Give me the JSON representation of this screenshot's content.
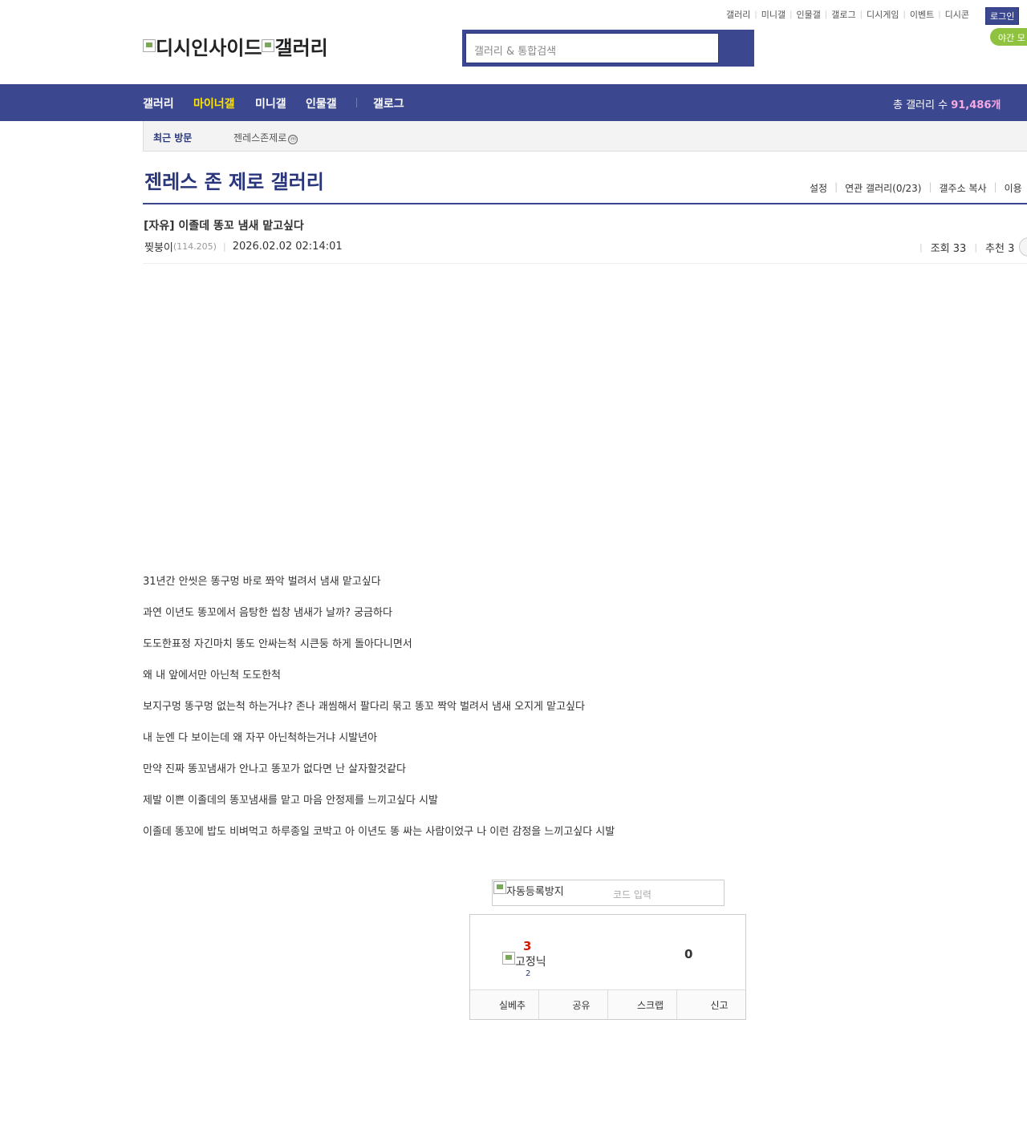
{
  "header": {
    "util_links": [
      "갤러리",
      "미니갤",
      "인물갤",
      "갤로그",
      "디시게임",
      "이벤트",
      "디시콘"
    ],
    "login_label": "로그인",
    "night_mode_label": "야간 모",
    "logo_text_1": "디시인사이드",
    "logo_text_2": "갤러리",
    "search_placeholder": "갤러리 & 통합검색"
  },
  "gnb": {
    "items": [
      "갤러리",
      "마이너갤",
      "미니갤",
      "인물갤",
      "갤로그"
    ],
    "total_label": "총 갤러리 수",
    "total_count": "91,486개"
  },
  "recent": {
    "label": "최근 방문",
    "item": "젠레스존제로",
    "badge": "ⓜ"
  },
  "gallery": {
    "title": "젠레스 존 제로 갤러리",
    "menu": [
      "설정",
      "연관 갤러리(0/23)",
      "갤주소 복사",
      "이용"
    ]
  },
  "post": {
    "title": "[자유] 이졸데 똥꼬 냄새 맡고싶다",
    "author": "찢붕이",
    "ip": "(114.205)",
    "date": "2026.02.02 02:14:01",
    "views_label": "조회 33",
    "recommend_label": "추천 3",
    "lines": [
      "31년간 안씻은 똥구멍 바로 쫘악 벌려서 냄새 맡고싶다",
      "과연 이년도 똥꼬에서 음탕한 씹창 냄새가 날까? 궁금하다",
      "도도한표정 자긴마치 똥도 안싸는척 시큰둥 하게 돌아다니면서",
      "왜 내 앞에서만 아닌척 도도한척",
      "보지구멍 똥구멍 없는척 하는거냐? 존나 괘씸해서 팔다리 묶고 똥꼬 짝악 벌려서 냄새 오지게 맡고싶다",
      "내 눈엔 다 보이는데 왜 자꾸 아닌척하는거냐 시발년아",
      "만약 진짜 똥꼬냄새가 안나고 똥꼬가 없다면 난 살자할것같다",
      "제발 이쁜 이졸데의 똥꼬냄새를 맡고 마음 안정제를 느끼고싶다 시발",
      "이졸데 똥꼬에 밥도 비벼먹고 하루종일 코박고 아 이년도 똥 싸는 사람이었구 나 이런 감정을 느끼고싶다 시발"
    ]
  },
  "captcha": {
    "image_alt": "자동등록방지",
    "code_placeholder": "코드 입력"
  },
  "recommend": {
    "up_count": "3",
    "fixed_alt": "고정닉",
    "fixed_count": "2",
    "down_count": "0",
    "buttons": [
      "실베추",
      "공유",
      "스크랩",
      "신고"
    ]
  }
}
